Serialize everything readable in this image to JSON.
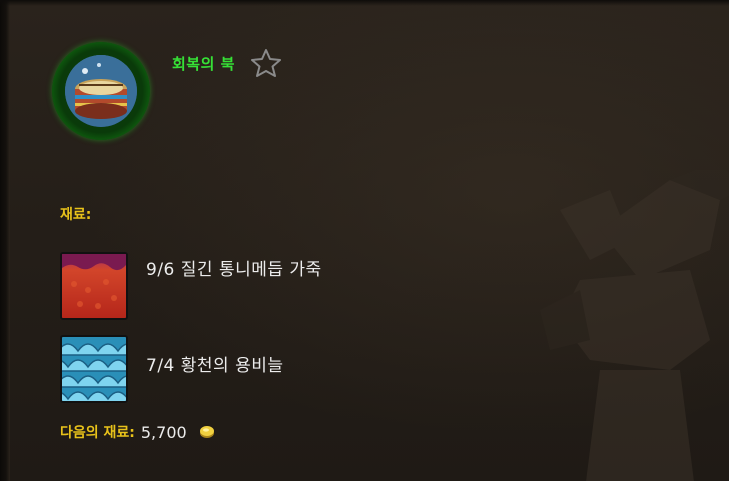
{
  "recipe": {
    "name": "회복의 북",
    "favorite_icon": "star-outline-icon",
    "item_icon": "drum-icon",
    "rarity_color": "#36e036"
  },
  "materials": {
    "label": "재료:",
    "items": [
      {
        "count": "9/6",
        "name": "질긴 통니메듭 가죽",
        "icon": "leather-icon"
      },
      {
        "count": "7/4",
        "name": "황천의 용비늘",
        "icon": "dragon-scale-icon"
      }
    ]
  },
  "cost": {
    "label": "다음의 재료:",
    "value": "5,700",
    "icon": "gold-coin-icon"
  },
  "colors": {
    "label_gold": "#e8c21a",
    "text": "#ececec",
    "background": "#241e18"
  }
}
